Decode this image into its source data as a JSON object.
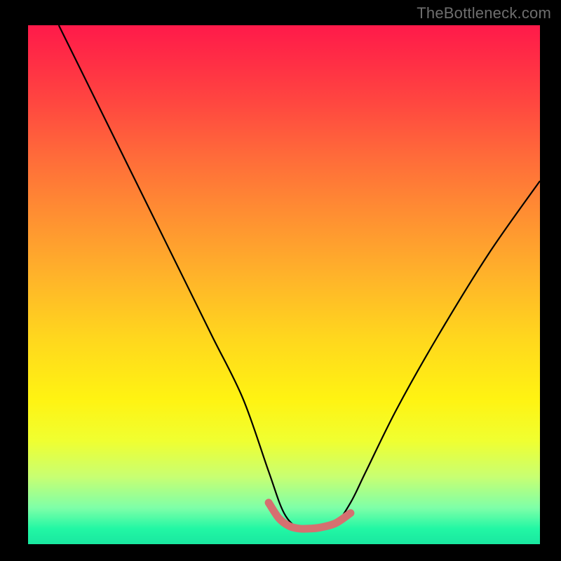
{
  "watermark": "TheBottleneck.com",
  "chart_data": {
    "type": "line",
    "title": "",
    "xlabel": "",
    "ylabel": "",
    "xlim": [
      0,
      100
    ],
    "ylim": [
      0,
      100
    ],
    "series": [
      {
        "name": "main-curve",
        "color": "#000000",
        "x": [
          6,
          12,
          18,
          24,
          30,
          36,
          42,
          47,
          50,
          53,
          56,
          60,
          63,
          66,
          72,
          80,
          90,
          100
        ],
        "y": [
          100,
          88,
          76,
          64,
          52,
          40,
          28,
          14,
          6,
          3,
          3,
          4,
          8,
          14,
          26,
          40,
          56,
          70
        ]
      },
      {
        "name": "valley-marker",
        "color": "#d57070",
        "x": [
          47,
          49,
          51,
          53,
          55,
          57,
          60,
          63
        ],
        "y": [
          8,
          5,
          3.5,
          3,
          3,
          3.2,
          4,
          6
        ]
      }
    ],
    "gradient_stops": [
      {
        "pos": 0,
        "color": "#ff1a4a"
      },
      {
        "pos": 7,
        "color": "#ff2e45"
      },
      {
        "pos": 15,
        "color": "#ff4740"
      },
      {
        "pos": 25,
        "color": "#ff6a3a"
      },
      {
        "pos": 35,
        "color": "#ff8a33"
      },
      {
        "pos": 48,
        "color": "#ffb22a"
      },
      {
        "pos": 60,
        "color": "#ffd61e"
      },
      {
        "pos": 72,
        "color": "#fff312"
      },
      {
        "pos": 80,
        "color": "#f0ff30"
      },
      {
        "pos": 87,
        "color": "#c8ff72"
      },
      {
        "pos": 93,
        "color": "#7effa8"
      },
      {
        "pos": 97,
        "color": "#22f7a4"
      },
      {
        "pos": 100,
        "color": "#19e7a0"
      }
    ]
  }
}
